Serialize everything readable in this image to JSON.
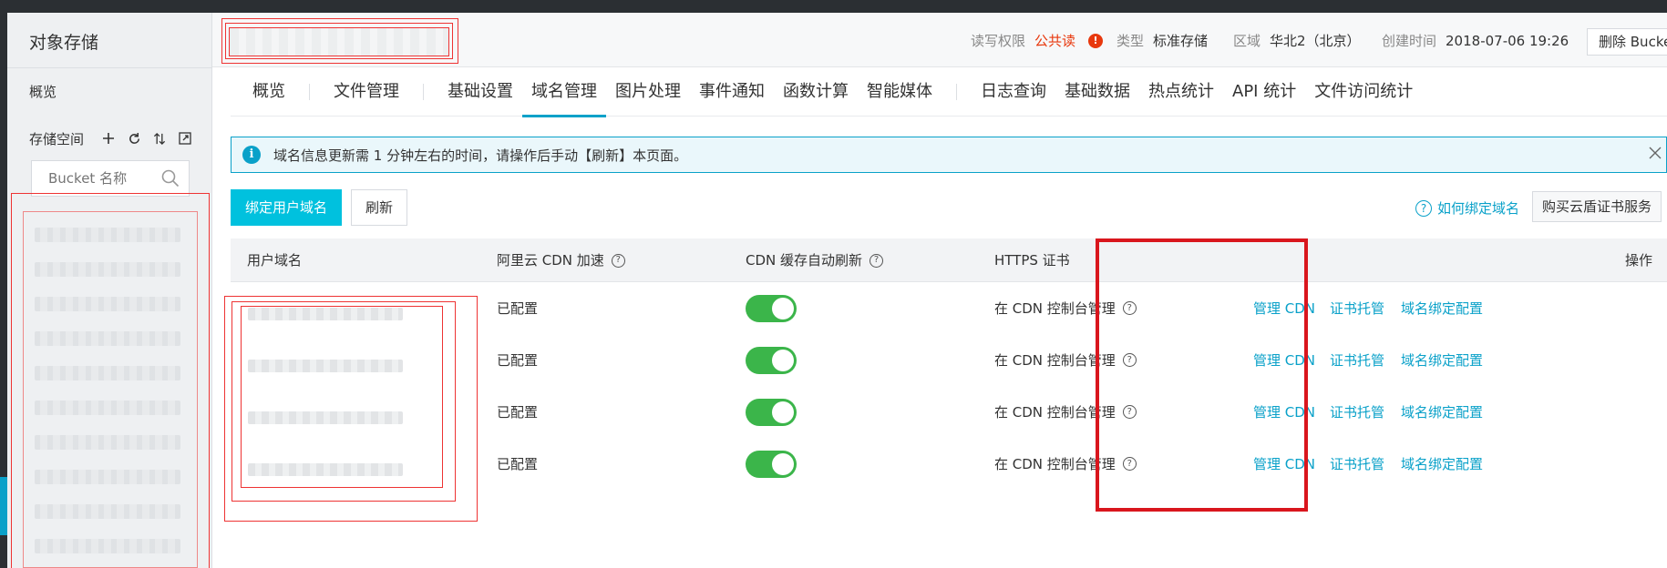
{
  "sidebar": {
    "title": "对象存储",
    "overview": "概览",
    "storage_label": "存储空间",
    "tools": [
      "plus-icon",
      "refresh-icon",
      "sort-icon",
      "expand-icon"
    ],
    "search_placeholder": "Bucket 名称"
  },
  "header": {
    "read_perm_key": "读写权限",
    "read_perm_value": "公共读",
    "type_key": "类型",
    "type_value": "标准存储",
    "region_key": "区域",
    "region_value": "华北2（北京）",
    "created_key": "创建时间",
    "created_value": "2018-07-06 19:26",
    "delete_label": "删除 Bucket"
  },
  "tabs": [
    {
      "label": "概览"
    },
    {
      "label": "文件管理"
    },
    {
      "label": "基础设置"
    },
    {
      "label": "域名管理",
      "active": true
    },
    {
      "label": "图片处理"
    },
    {
      "label": "事件通知"
    },
    {
      "label": "函数计算"
    },
    {
      "label": "智能媒体"
    },
    {
      "label": "日志查询"
    },
    {
      "label": "基础数据"
    },
    {
      "label": "热点统计"
    },
    {
      "label": "API 统计"
    },
    {
      "label": "文件访问统计"
    }
  ],
  "notice": {
    "text": "域名信息更新需 1 分钟左右的时间，请操作后手动【刷新】本页面。"
  },
  "toolbar": {
    "bind_label": "绑定用户域名",
    "refresh_label": "刷新",
    "help_label": "如何绑定域名",
    "buy_cert_label": "购买云盾证书服务"
  },
  "table": {
    "headers": {
      "domain": "用户域名",
      "cdn": "阿里云 CDN 加速",
      "cdn_refresh": "CDN 缓存自动刷新",
      "https": "HTTPS 证书",
      "actions": "操作"
    },
    "rows": [
      {
        "cdn": "已配置",
        "refresh_on": true,
        "https": "在 CDN 控制台管理",
        "ops": [
          "管理 CDN",
          "证书托管",
          "域名绑定配置"
        ]
      },
      {
        "cdn": "已配置",
        "refresh_on": true,
        "https": "在 CDN 控制台管理",
        "ops": [
          "管理 CDN",
          "证书托管",
          "域名绑定配置"
        ]
      },
      {
        "cdn": "已配置",
        "refresh_on": true,
        "https": "在 CDN 控制台管理",
        "ops": [
          "管理 CDN",
          "证书托管",
          "域名绑定配置"
        ]
      },
      {
        "cdn": "已配置",
        "refresh_on": true,
        "https": "在 CDN 控制台管理",
        "ops": [
          "管理 CDN",
          "证书托管",
          "域名绑定配置"
        ]
      }
    ]
  },
  "colors": {
    "accent": "#00c1de",
    "link": "#0aa1c9",
    "toggle_on": "#3bb54a",
    "warning": "#e8380d",
    "highlight_box": "#d9161d"
  }
}
